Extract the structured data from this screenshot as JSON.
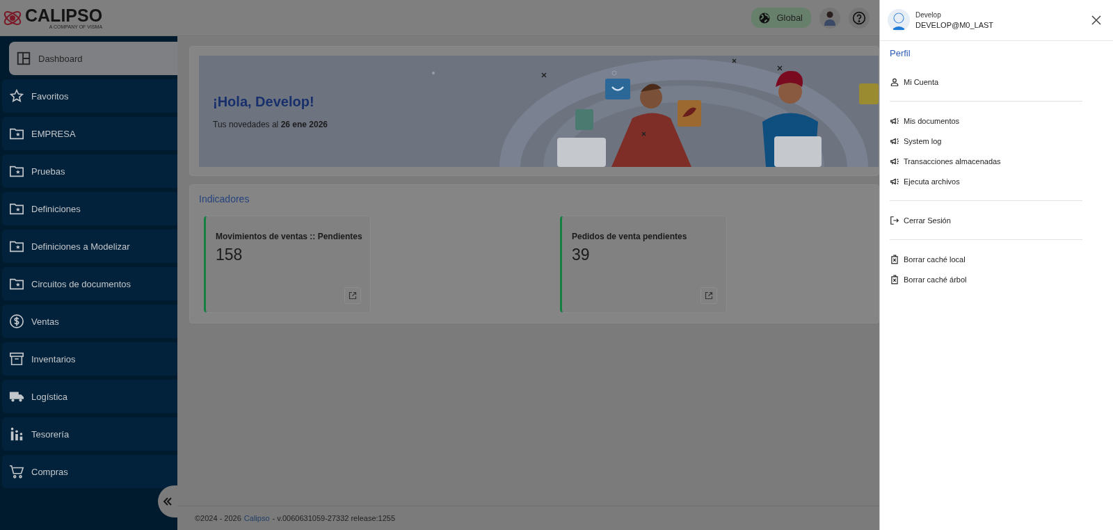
{
  "header": {
    "logo": "CALIPSO",
    "tagline": "A COMPANY OF VISMA",
    "region_button": "Global"
  },
  "sidebar": {
    "items": [
      {
        "label": "Dashboard",
        "kind": "dashboard",
        "selected": true
      },
      {
        "label": "Favoritos",
        "kind": "star",
        "selected": false
      },
      {
        "label": "EMPRESA",
        "kind": "folder",
        "selected": false
      },
      {
        "label": "Pruebas",
        "kind": "folder",
        "selected": false
      },
      {
        "label": "Definiciones",
        "kind": "folder",
        "selected": false
      },
      {
        "label": "Definiciones a Modelizar",
        "kind": "folder",
        "selected": false
      },
      {
        "label": "Circuitos de documentos",
        "kind": "folder",
        "selected": false
      },
      {
        "label": "Ventas",
        "kind": "dollar",
        "selected": false
      },
      {
        "label": "Inventarios",
        "kind": "archive",
        "selected": false
      },
      {
        "label": "Logística",
        "kind": "truck",
        "selected": false
      },
      {
        "label": "Tesorería",
        "kind": "bars",
        "selected": false
      },
      {
        "label": "Compras",
        "kind": "cart",
        "selected": false
      }
    ]
  },
  "banner": {
    "greeting": "¡Hola, Develop!",
    "subtitle": "Tus novedades al **26 ene 2026**"
  },
  "indicators": {
    "title": "Indicadores",
    "cards": [
      {
        "title": "Movimientos de ventas :: Pendientes",
        "value": "158"
      },
      {
        "title": "Pedidos de venta pendientes",
        "value": "39"
      }
    ]
  },
  "footer": {
    "copyright": "©2024 - 2026",
    "link": "Calipso",
    "version": "- v.0060631059-27332 release:1255"
  },
  "drawer": {
    "user_name": "Develop",
    "login": "DEVELOP@M0_LAST",
    "section_title": "Perfil",
    "groups": [
      [
        {
          "label": "Mi Cuenta",
          "kind": "user"
        }
      ],
      [
        {
          "label": "Mis documentos",
          "kind": "megaphone"
        },
        {
          "label": "System log",
          "kind": "megaphone"
        },
        {
          "label": "Transacciones almacenadas",
          "kind": "megaphone"
        },
        {
          "label": "Ejecuta archivos",
          "kind": "megaphone"
        }
      ],
      [
        {
          "label": "Cerrar Sesión",
          "kind": "logout"
        }
      ],
      [
        {
          "label": "Borrar caché local",
          "kind": "clear"
        },
        {
          "label": "Borrar caché árbol",
          "kind": "clear"
        }
      ]
    ]
  }
}
